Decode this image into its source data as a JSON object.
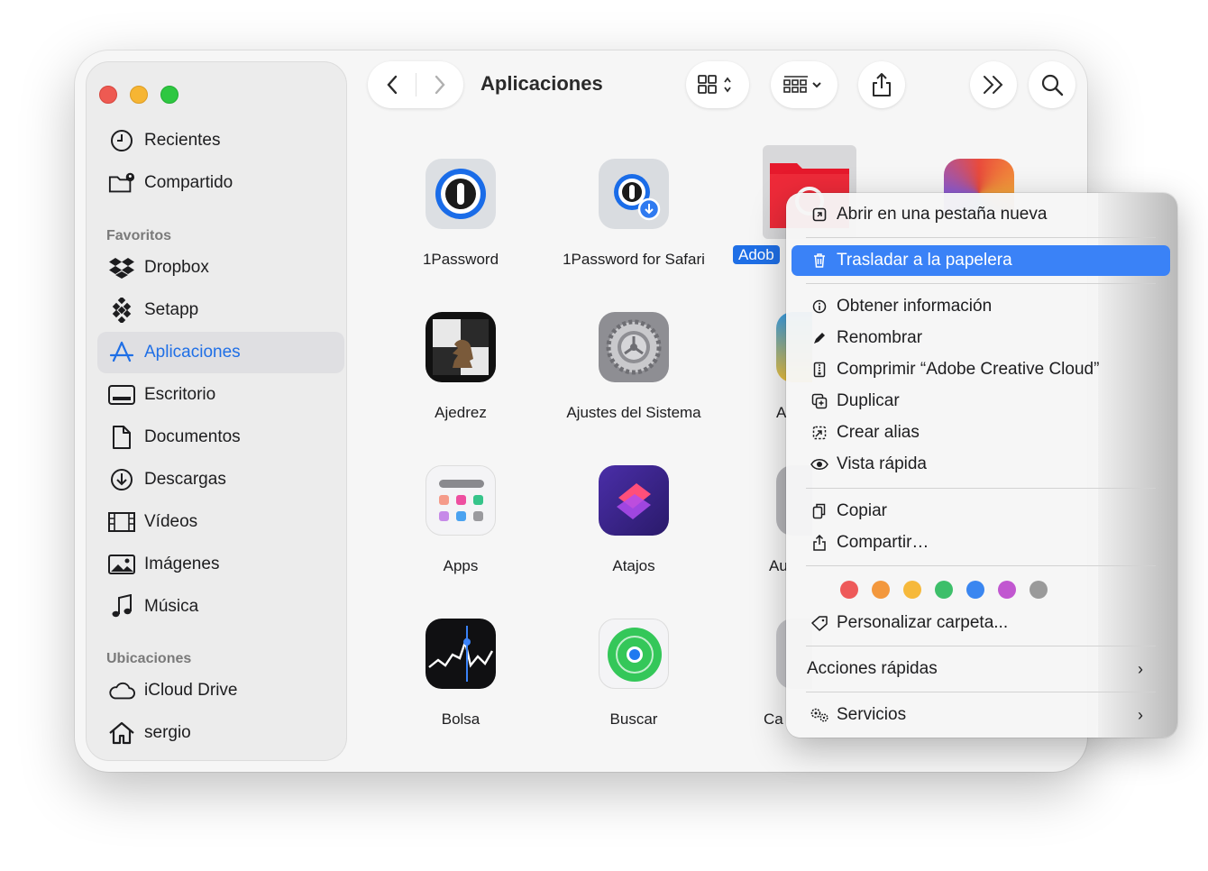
{
  "window": {
    "title": "Aplicaciones"
  },
  "sidebar": {
    "top_items": [
      {
        "label": "Recientes",
        "icon": "clock-icon"
      },
      {
        "label": "Compartido",
        "icon": "shared-folder-icon"
      }
    ],
    "favorites_heading": "Favoritos",
    "favorites": [
      {
        "label": "Dropbox",
        "icon": "dropbox-icon"
      },
      {
        "label": "Setapp",
        "icon": "setapp-icon"
      },
      {
        "label": "Aplicaciones",
        "icon": "applications-icon",
        "selected": true
      },
      {
        "label": "Escritorio",
        "icon": "desktop-icon"
      },
      {
        "label": "Documentos",
        "icon": "document-icon"
      },
      {
        "label": "Descargas",
        "icon": "download-icon"
      },
      {
        "label": "Vídeos",
        "icon": "film-icon"
      },
      {
        "label": "Imágenes",
        "icon": "photo-icon"
      },
      {
        "label": "Música",
        "icon": "music-icon"
      }
    ],
    "locations_heading": "Ubicaciones",
    "locations": [
      {
        "label": "iCloud Drive",
        "icon": "cloud-icon"
      },
      {
        "label": "sergio",
        "icon": "home-icon"
      }
    ]
  },
  "apps": [
    {
      "label": "1Password"
    },
    {
      "label": "1Password for Safari"
    },
    {
      "label": "Adob"
    },
    {
      "label": "Ajedrez"
    },
    {
      "label": "Ajustes del Sistema"
    },
    {
      "label": "A"
    },
    {
      "label": "Apps"
    },
    {
      "label": "Atajos"
    },
    {
      "label": "Au"
    },
    {
      "label": "Bolsa"
    },
    {
      "label": "Buscar"
    },
    {
      "label": "Ca"
    }
  ],
  "context_menu": {
    "items": [
      {
        "label": "Abrir en una pestaña nueva",
        "icon": "new-tab-icon"
      },
      {
        "label": "Trasladar a la papelera",
        "icon": "trash-icon",
        "highlighted": true
      },
      {
        "label": "Obtener información",
        "icon": "info-icon"
      },
      {
        "label": "Renombrar",
        "icon": "pencil-icon"
      },
      {
        "label": "Comprimir “Adobe Creative Cloud”",
        "icon": "archive-icon"
      },
      {
        "label": "Duplicar",
        "icon": "duplicate-icon"
      },
      {
        "label": "Crear alias",
        "icon": "alias-icon"
      },
      {
        "label": "Vista rápida",
        "icon": "eye-icon"
      },
      {
        "label": "Copiar",
        "icon": "copy-icon"
      },
      {
        "label": "Compartir…",
        "icon": "share-icon"
      },
      {
        "label": "Personalizar carpeta...",
        "icon": "tag-icon"
      },
      {
        "label": "Acciones rápidas",
        "icon": ""
      },
      {
        "label": "Servicios",
        "icon": "gears-icon"
      }
    ],
    "tag_colors": [
      "#ee5a5a",
      "#f3983d",
      "#f6b93b",
      "#3dbf6a",
      "#3a86f0",
      "#c157d0",
      "#9a9a9a"
    ]
  },
  "colors": {
    "accent": "#1f6fe6",
    "highlight": "#3a82f7"
  }
}
